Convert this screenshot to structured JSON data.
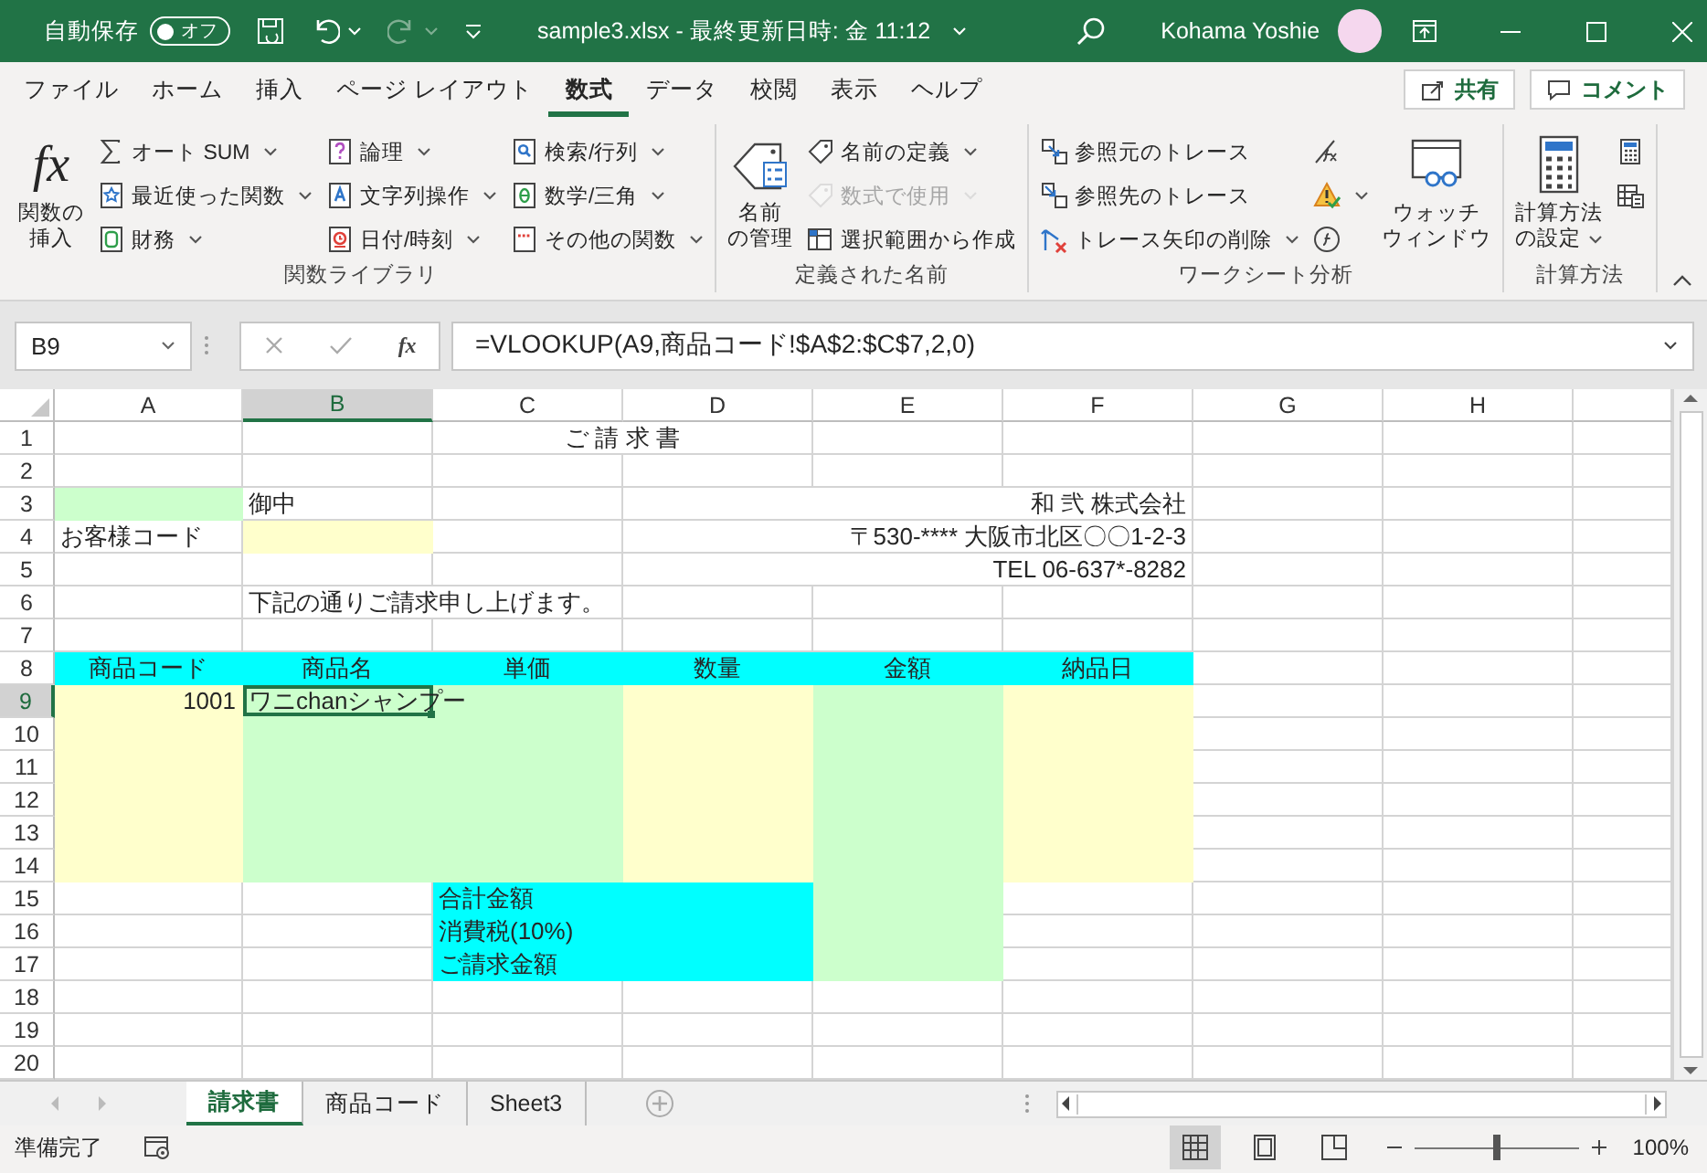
{
  "title_bar": {
    "autosave_label": "自動保存",
    "autosave": {
      "on": false,
      "label": "オフ"
    },
    "title": "sample3.xlsx - 最終更新日時: 金 11:12",
    "user": "Kohama Yoshie"
  },
  "menu": {
    "tabs": [
      {
        "label": "ファイル",
        "selected": false
      },
      {
        "label": "ホーム",
        "selected": false
      },
      {
        "label": "挿入",
        "selected": false
      },
      {
        "label": "ページ レイアウト",
        "selected": false
      },
      {
        "label": "数式",
        "selected": true
      },
      {
        "label": "データ",
        "selected": false
      },
      {
        "label": "校閲",
        "selected": false
      },
      {
        "label": "表示",
        "selected": false
      },
      {
        "label": "ヘルプ",
        "selected": false
      }
    ],
    "actions": [
      "共有",
      "コメント"
    ]
  },
  "ribbon": {
    "groups": [
      {
        "label": "関数ライブラリ",
        "items": [
          {
            "kind": "large",
            "glyph": "fx",
            "lines": [
              "関数の",
              "挿入"
            ],
            "dropdown": false
          },
          {
            "kind": "column",
            "buttons": [
              {
                "label": "オート SUM",
                "dropdown": true,
                "disabled": false
              },
              {
                "label": "最近使った関数",
                "dropdown": true,
                "disabled": false
              },
              {
                "label": "財務",
                "dropdown": true,
                "disabled": false
              }
            ]
          },
          {
            "kind": "column",
            "buttons": [
              {
                "label": "論理",
                "dropdown": true,
                "disabled": false
              },
              {
                "label": "文字列操作",
                "dropdown": true,
                "disabled": false
              },
              {
                "label": "日付/時刻",
                "dropdown": true,
                "disabled": false
              }
            ]
          },
          {
            "kind": "column",
            "buttons": [
              {
                "label": "検索/行列",
                "dropdown": true,
                "disabled": false
              },
              {
                "label": "数学/三角",
                "dropdown": true,
                "disabled": false
              },
              {
                "label": "その他の関数",
                "dropdown": true,
                "disabled": false
              }
            ]
          }
        ]
      },
      {
        "label": "定義された名前",
        "items": [
          {
            "kind": "large",
            "lines": [
              "名前",
              "の管理"
            ],
            "dropdown": false
          },
          {
            "kind": "column",
            "buttons": [
              {
                "label": "名前の定義",
                "dropdown": true,
                "disabled": false
              },
              {
                "label": "数式で使用",
                "dropdown": true,
                "disabled": true
              },
              {
                "label": "選択範囲から作成",
                "dropdown": false,
                "disabled": false
              }
            ]
          }
        ]
      },
      {
        "label": "ワークシート分析",
        "items": [
          {
            "kind": "column",
            "buttons": [
              {
                "label": "参照元のトレース",
                "dropdown": false,
                "disabled": false
              },
              {
                "label": "参照先のトレース",
                "dropdown": false,
                "disabled": false
              },
              {
                "label": "トレース矢印の削除",
                "dropdown": true,
                "disabled": false
              }
            ]
          },
          {
            "kind": "column",
            "buttons": [
              {
                "dropdown": false,
                "disabled": false
              },
              {
                "dropdown": true,
                "disabled": false
              },
              {
                "dropdown": false,
                "disabled": false
              }
            ]
          },
          {
            "kind": "large",
            "lines": [
              "ウォッチ",
              "ウィンドウ"
            ],
            "dropdown": false
          }
        ]
      },
      {
        "label": "計算方法",
        "items": [
          {
            "kind": "large",
            "lines": [
              "計算方法",
              "の設定"
            ],
            "dropdown": true
          },
          {
            "kind": "column",
            "buttons": [
              {
                "dropdown": false,
                "disabled": false
              },
              {
                "dropdown": false,
                "disabled": false
              }
            ]
          }
        ]
      }
    ]
  },
  "formula_bar": {
    "name_box": "B9",
    "insert_function": "fx",
    "formula": "=VLOOKUP(A9,商品コード!$A$2:$C$7,2,0)"
  },
  "sheet": {
    "columns": [
      {
        "label": "A",
        "selected": false
      },
      {
        "label": "B",
        "selected": true
      },
      {
        "label": "C",
        "selected": false
      },
      {
        "label": "D",
        "selected": false
      },
      {
        "label": "E",
        "selected": false
      },
      {
        "label": "F",
        "selected": false
      },
      {
        "label": "G",
        "selected": false
      },
      {
        "label": "H",
        "selected": false
      }
    ],
    "rows": [
      {
        "number": "1",
        "selected": false,
        "cells": [
          {
            "kind": "blank",
            "selected": false
          },
          {
            "kind": "blank",
            "selected": false
          },
          {
            "kind": "title",
            "text": "ご 請 求 書",
            "selected": false
          },
          {
            "kind": "covered"
          },
          {
            "kind": "blank",
            "selected": false
          },
          {
            "kind": "blank",
            "selected": false
          },
          {
            "kind": "blank",
            "selected": false
          },
          {
            "kind": "blank",
            "selected": false
          }
        ]
      },
      {
        "number": "2",
        "selected": false,
        "cells": [
          {
            "kind": "blank",
            "selected": false
          },
          {
            "kind": "blank",
            "selected": false
          },
          {
            "kind": "blank",
            "selected": false
          },
          {
            "kind": "blank",
            "selected": false
          },
          {
            "kind": "blank",
            "selected": false
          },
          {
            "kind": "blank",
            "selected": false
          },
          {
            "kind": "blank",
            "selected": false
          },
          {
            "kind": "blank",
            "selected": false
          }
        ]
      },
      {
        "number": "3",
        "selected": false,
        "cells": [
          {
            "kind": "blank",
            "color": "#ccffcc",
            "selected": false
          },
          {
            "kind": "text",
            "text": "御中",
            "selected": false
          },
          {
            "kind": "blank",
            "selected": false
          },
          {
            "kind": "address",
            "text": "和 弐 株式会社",
            "selected": false
          },
          {
            "kind": "covered"
          },
          {
            "kind": "covered"
          },
          {
            "kind": "blank",
            "selected": false
          },
          {
            "kind": "blank",
            "selected": false
          }
        ]
      },
      {
        "number": "4",
        "selected": false,
        "cells": [
          {
            "kind": "text",
            "text": "お客様コード",
            "selected": false
          },
          {
            "kind": "blank",
            "color": "#ffffcc",
            "selected": false
          },
          {
            "kind": "blank",
            "selected": false
          },
          {
            "kind": "address",
            "text": "〒530-****  大阪市北区〇〇1-2-3",
            "selected": false
          },
          {
            "kind": "covered"
          },
          {
            "kind": "covered"
          },
          {
            "kind": "blank",
            "selected": false
          },
          {
            "kind": "blank",
            "selected": false
          }
        ]
      },
      {
        "number": "5",
        "selected": false,
        "cells": [
          {
            "kind": "blank",
            "selected": false
          },
          {
            "kind": "blank",
            "selected": false
          },
          {
            "kind": "blank",
            "selected": false
          },
          {
            "kind": "address",
            "text": "TEL  06-637*-8282",
            "selected": false
          },
          {
            "kind": "covered"
          },
          {
            "kind": "covered"
          },
          {
            "kind": "blank",
            "selected": false
          },
          {
            "kind": "blank",
            "selected": false
          }
        ]
      },
      {
        "number": "6",
        "selected": false,
        "cells": [
          {
            "kind": "blank",
            "selected": false
          },
          {
            "kind": "note",
            "text": "下記の通りご請求申し上げます。",
            "selected": false
          },
          {
            "kind": "covered"
          },
          {
            "kind": "blank",
            "selected": false
          },
          {
            "kind": "blank",
            "selected": false
          },
          {
            "kind": "blank",
            "selected": false
          },
          {
            "kind": "blank",
            "selected": false
          },
          {
            "kind": "blank",
            "selected": false
          }
        ]
      },
      {
        "number": "7",
        "selected": false,
        "cells": [
          {
            "kind": "blank",
            "selected": false
          },
          {
            "kind": "blank",
            "selected": false
          },
          {
            "kind": "blank",
            "selected": false
          },
          {
            "kind": "blank",
            "selected": false
          },
          {
            "kind": "blank",
            "selected": false
          },
          {
            "kind": "blank",
            "selected": false
          },
          {
            "kind": "blank",
            "selected": false
          },
          {
            "kind": "blank",
            "selected": false
          }
        ]
      },
      {
        "number": "8",
        "selected": false,
        "cells": [
          {
            "kind": "heading",
            "text": "商品コード",
            "color": "#00ffff",
            "selected": false
          },
          {
            "kind": "heading",
            "text": "商品名",
            "color": "#00ffff",
            "selected": false
          },
          {
            "kind": "heading",
            "text": "単価",
            "color": "#00ffff",
            "selected": false
          },
          {
            "kind": "heading",
            "text": "数量",
            "color": "#00ffff",
            "selected": false
          },
          {
            "kind": "heading",
            "text": "金額",
            "color": "#00ffff",
            "selected": false
          },
          {
            "kind": "heading",
            "text": "納品日",
            "color": "#00ffff",
            "selected": false
          },
          {
            "kind": "blank",
            "selected": false
          },
          {
            "kind": "blank",
            "selected": false
          }
        ]
      },
      {
        "number": "9",
        "selected": true,
        "cells": [
          {
            "kind": "number",
            "text": "1001",
            "color": "#ffffcc",
            "selected": false
          },
          {
            "kind": "text",
            "text": "ワニchanシャンプー",
            "color": "#ccffcc",
            "selected": true
          },
          {
            "kind": "overflow"
          },
          {
            "kind": "blank",
            "color": "#ffffcc",
            "selected": false
          },
          {
            "kind": "blank",
            "color": "#ccffcc",
            "selected": false
          },
          {
            "kind": "blank",
            "color": "#ffffcc",
            "selected": false
          },
          {
            "kind": "blank",
            "selected": false
          },
          {
            "kind": "blank",
            "selected": false
          }
        ]
      },
      {
        "number": "10",
        "selected": false,
        "cells": [
          {
            "kind": "blank",
            "color": "#ffffcc",
            "selected": false
          },
          {
            "kind": "blank",
            "color": "#ccffcc",
            "selected": false
          },
          {
            "kind": "blank",
            "color": "#ccffcc",
            "selected": false
          },
          {
            "kind": "blank",
            "color": "#ffffcc",
            "selected": false
          },
          {
            "kind": "blank",
            "color": "#ccffcc",
            "selected": false
          },
          {
            "kind": "blank",
            "color": "#ffffcc",
            "selected": false
          },
          {
            "kind": "blank",
            "selected": false
          },
          {
            "kind": "blank",
            "selected": false
          }
        ]
      },
      {
        "number": "11",
        "selected": false,
        "cells": [
          {
            "kind": "blank",
            "color": "#ffffcc",
            "selected": false
          },
          {
            "kind": "blank",
            "color": "#ccffcc",
            "selected": false
          },
          {
            "kind": "blank",
            "color": "#ccffcc",
            "selected": false
          },
          {
            "kind": "blank",
            "color": "#ffffcc",
            "selected": false
          },
          {
            "kind": "blank",
            "color": "#ccffcc",
            "selected": false
          },
          {
            "kind": "blank",
            "color": "#ffffcc",
            "selected": false
          },
          {
            "kind": "blank",
            "selected": false
          },
          {
            "kind": "blank",
            "selected": false
          }
        ]
      },
      {
        "number": "12",
        "selected": false,
        "cells": [
          {
            "kind": "blank",
            "color": "#ffffcc",
            "selected": false
          },
          {
            "kind": "blank",
            "color": "#ccffcc",
            "selected": false
          },
          {
            "kind": "blank",
            "color": "#ccffcc",
            "selected": false
          },
          {
            "kind": "blank",
            "color": "#ffffcc",
            "selected": false
          },
          {
            "kind": "blank",
            "color": "#ccffcc",
            "selected": false
          },
          {
            "kind": "blank",
            "color": "#ffffcc",
            "selected": false
          },
          {
            "kind": "blank",
            "selected": false
          },
          {
            "kind": "blank",
            "selected": false
          }
        ]
      },
      {
        "number": "13",
        "selected": false,
        "cells": [
          {
            "kind": "blank",
            "color": "#ffffcc",
            "selected": false
          },
          {
            "kind": "blank",
            "color": "#ccffcc",
            "selected": false
          },
          {
            "kind": "blank",
            "color": "#ccffcc",
            "selected": false
          },
          {
            "kind": "blank",
            "color": "#ffffcc",
            "selected": false
          },
          {
            "kind": "blank",
            "color": "#ccffcc",
            "selected": false
          },
          {
            "kind": "blank",
            "color": "#ffffcc",
            "selected": false
          },
          {
            "kind": "blank",
            "selected": false
          },
          {
            "kind": "blank",
            "selected": false
          }
        ]
      },
      {
        "number": "14",
        "selected": false,
        "cells": [
          {
            "kind": "blank",
            "color": "#ffffcc",
            "selected": false
          },
          {
            "kind": "blank",
            "color": "#ccffcc",
            "selected": false
          },
          {
            "kind": "blank",
            "color": "#ccffcc",
            "selected": false
          },
          {
            "kind": "blank",
            "color": "#ffffcc",
            "selected": false
          },
          {
            "kind": "blank",
            "color": "#ccffcc",
            "selected": false
          },
          {
            "kind": "blank",
            "color": "#ffffcc",
            "selected": false
          },
          {
            "kind": "blank",
            "selected": false
          },
          {
            "kind": "blank",
            "selected": false
          }
        ]
      },
      {
        "number": "15",
        "selected": false,
        "cells": [
          {
            "kind": "blank",
            "selected": false
          },
          {
            "kind": "blank",
            "selected": false
          },
          {
            "kind": "text",
            "text": "合計金額",
            "color": "#00ffff",
            "selected": false
          },
          {
            "kind": "blank",
            "color": "#00ffff",
            "selected": false
          },
          {
            "kind": "blank",
            "color": "#ccffcc",
            "selected": false
          },
          {
            "kind": "blank",
            "selected": false
          },
          {
            "kind": "blank",
            "selected": false
          },
          {
            "kind": "blank",
            "selected": false
          }
        ]
      },
      {
        "number": "16",
        "selected": false,
        "cells": [
          {
            "kind": "blank",
            "selected": false
          },
          {
            "kind": "blank",
            "selected": false
          },
          {
            "kind": "text",
            "text": "消費税(10%)",
            "color": "#00ffff",
            "selected": false
          },
          {
            "kind": "blank",
            "color": "#00ffff",
            "selected": false
          },
          {
            "kind": "blank",
            "color": "#ccffcc",
            "selected": false
          },
          {
            "kind": "blank",
            "selected": false
          },
          {
            "kind": "blank",
            "selected": false
          },
          {
            "kind": "blank",
            "selected": false
          }
        ]
      },
      {
        "number": "17",
        "selected": false,
        "cells": [
          {
            "kind": "blank",
            "selected": false
          },
          {
            "kind": "blank",
            "selected": false
          },
          {
            "kind": "text",
            "text": "ご請求金額",
            "color": "#00ffff",
            "selected": false
          },
          {
            "kind": "blank",
            "color": "#00ffff",
            "selected": false
          },
          {
            "kind": "blank",
            "color": "#ccffcc",
            "selected": false
          },
          {
            "kind": "blank",
            "selected": false
          },
          {
            "kind": "blank",
            "selected": false
          },
          {
            "kind": "blank",
            "selected": false
          }
        ]
      },
      {
        "number": "18",
        "selected": false,
        "cells": [
          {
            "kind": "blank",
            "selected": false
          },
          {
            "kind": "blank",
            "selected": false
          },
          {
            "kind": "blank",
            "selected": false
          },
          {
            "kind": "blank",
            "selected": false
          },
          {
            "kind": "blank",
            "selected": false
          },
          {
            "kind": "blank",
            "selected": false
          },
          {
            "kind": "blank",
            "selected": false
          },
          {
            "kind": "blank",
            "selected": false
          }
        ]
      },
      {
        "number": "19",
        "selected": false,
        "cells": [
          {
            "kind": "blank",
            "selected": false
          },
          {
            "kind": "blank",
            "selected": false
          },
          {
            "kind": "blank",
            "selected": false
          },
          {
            "kind": "blank",
            "selected": false
          },
          {
            "kind": "blank",
            "selected": false
          },
          {
            "kind": "blank",
            "selected": false
          },
          {
            "kind": "blank",
            "selected": false
          },
          {
            "kind": "blank",
            "selected": false
          }
        ]
      },
      {
        "number": "20",
        "selected": false,
        "cells": [
          {
            "kind": "blank",
            "selected": false
          },
          {
            "kind": "blank",
            "selected": false
          },
          {
            "kind": "blank",
            "selected": false
          },
          {
            "kind": "blank",
            "selected": false
          },
          {
            "kind": "blank",
            "selected": false
          },
          {
            "kind": "blank",
            "selected": false
          },
          {
            "kind": "blank",
            "selected": false
          },
          {
            "kind": "blank",
            "selected": false
          }
        ]
      }
    ]
  },
  "sheet_tabs": [
    {
      "label": "請求書",
      "selected": true
    },
    {
      "label": "商品コード",
      "selected": false
    },
    {
      "label": "Sheet3",
      "selected": false
    }
  ],
  "status_bar": {
    "status": "準備完了",
    "views": [
      {
        "selected": true
      },
      {
        "selected": false
      },
      {
        "selected": false
      }
    ],
    "zoom": {
      "level": 0.5,
      "reading": "100%"
    }
  }
}
